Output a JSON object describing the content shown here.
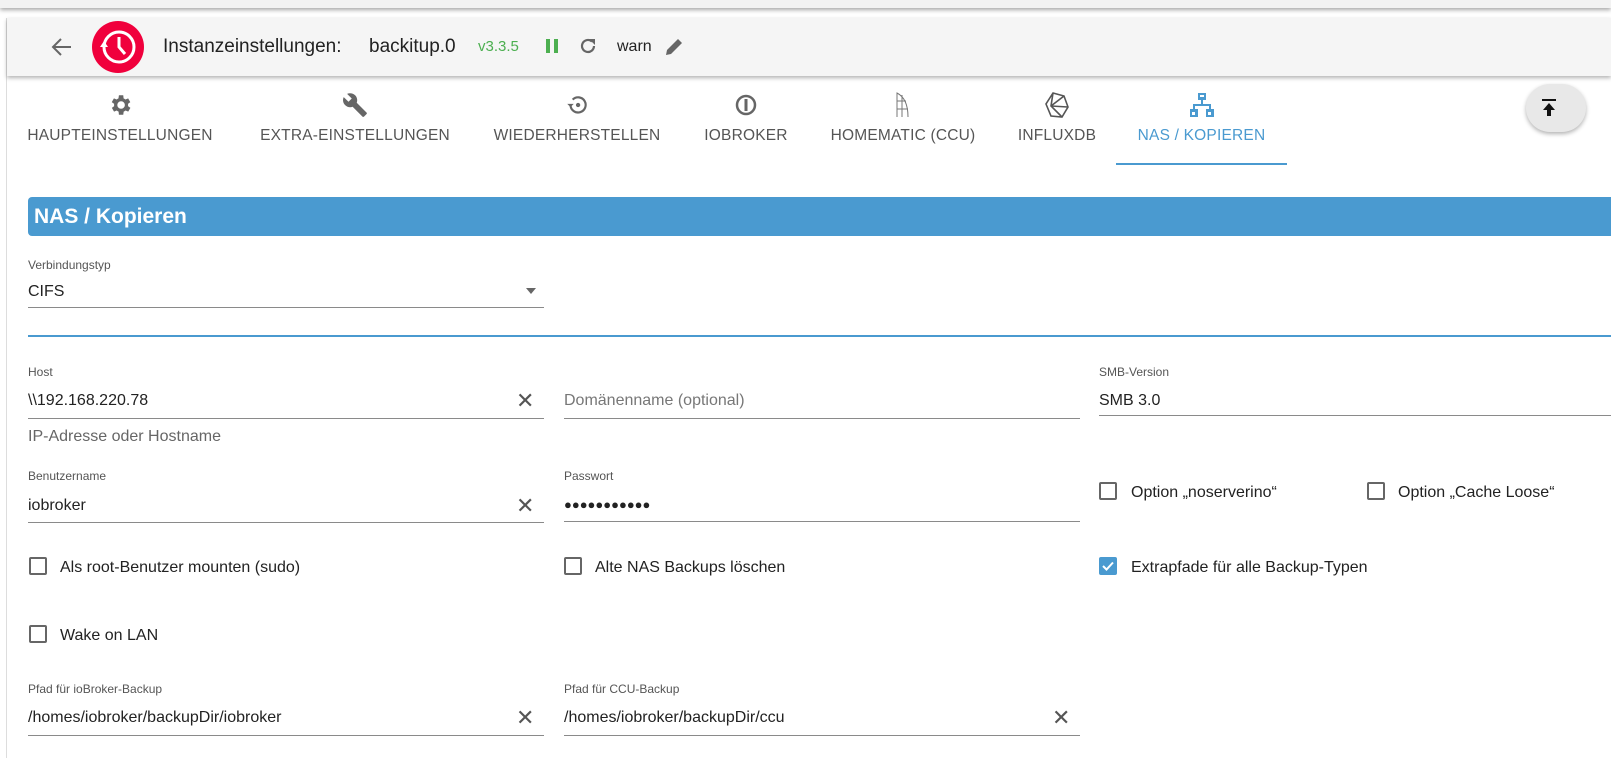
{
  "header": {
    "title": "Instanzeinstellungen:",
    "instance": "backitup.0",
    "version": "v3.3.5",
    "log_level": "warn",
    "logo_color": "#f0003c"
  },
  "tabs": [
    {
      "label": "HAUPTEINSTELLUNGEN",
      "icon": "gear-icon"
    },
    {
      "label": "EXTRA-EINSTELLUNGEN",
      "icon": "wrench-icon"
    },
    {
      "label": "WIEDERHERSTELLEN",
      "icon": "restore-icon"
    },
    {
      "label": "IOBROKER",
      "icon": "iobroker-icon"
    },
    {
      "label": "HOMEMATIC (CCU)",
      "icon": "homematic-icon"
    },
    {
      "label": "INFLUXDB",
      "icon": "influxdb-icon"
    },
    {
      "label": "NAS / KOPIEREN",
      "icon": "network-icon",
      "active": true
    }
  ],
  "section": {
    "title": "NAS / Kopieren",
    "color": "#4a9ad0"
  },
  "form": {
    "connection_type": {
      "label": "Verbindungstyp",
      "value": "CIFS"
    },
    "host": {
      "label": "Host",
      "value": "\\\\192.168.220.78",
      "helper": "IP-Adresse oder Hostname"
    },
    "domain": {
      "placeholder": "Domänenname (optional)"
    },
    "smb_version": {
      "label": "SMB-Version",
      "value": "SMB 3.0"
    },
    "username": {
      "label": "Benutzername",
      "value": "iobroker"
    },
    "password": {
      "label": "Passwort",
      "value": "●●●●●●●●●●●"
    },
    "noserverino": {
      "label": "Option „noserverino“",
      "checked": false
    },
    "cache_loose": {
      "label": "Option „Cache Loose“",
      "checked": false
    },
    "sudo": {
      "label": "Als root-Benutzer mounten (sudo)",
      "checked": false
    },
    "delete_old": {
      "label": "Alte NAS Backups löschen",
      "checked": false
    },
    "extra_paths": {
      "label": "Extrapfade für alle Backup-Typen",
      "checked": true
    },
    "wake_on_lan": {
      "label": "Wake on LAN",
      "checked": false
    },
    "iobroker_path": {
      "label": "Pfad für ioBroker-Backup",
      "value": "/homes/iobroker/backupDir/iobroker"
    },
    "ccu_path": {
      "label": "Pfad für CCU-Backup",
      "value": "/homes/iobroker/backupDir/ccu"
    }
  }
}
